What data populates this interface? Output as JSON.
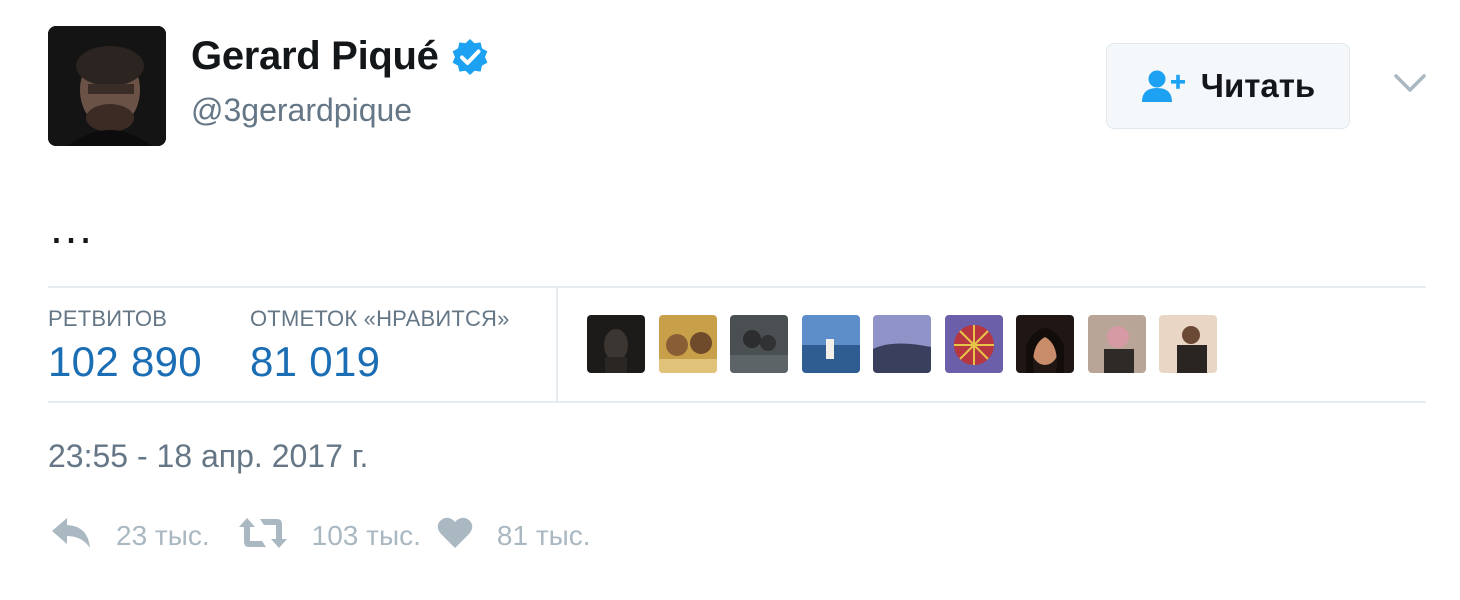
{
  "user": {
    "display_name": "Gerard Piqué",
    "handle": "@3gerardpique",
    "verified_icon": "verified-badge-icon",
    "avatar": "profile-photo"
  },
  "follow_button": {
    "label": "Читать",
    "icon": "add-user-icon"
  },
  "menu_icon": "chevron-down-icon",
  "tweet": {
    "text": "…"
  },
  "stats": {
    "retweets": {
      "label": "РЕТВИТОВ",
      "value": "102 890"
    },
    "likes": {
      "label": "ОТМЕТОК «НРАВИТСЯ»",
      "value": "81 019"
    }
  },
  "likers_count_shown": 9,
  "timestamp": "23:55 - 18 апр. 2017 г.",
  "actions": {
    "reply": {
      "icon": "reply-icon",
      "count": "23 тыс."
    },
    "retweet": {
      "icon": "retweet-icon",
      "count": "103 тыс."
    },
    "like": {
      "icon": "heart-icon",
      "count": "81 тыс."
    }
  },
  "colors": {
    "accent_blue": "#1b6db4",
    "verified_blue": "#1da1f2",
    "muted_text": "#657786",
    "action_gray": "#aab8c2"
  }
}
